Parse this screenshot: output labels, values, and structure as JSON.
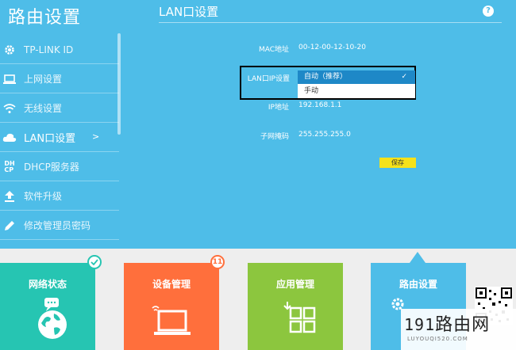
{
  "sidebar": {
    "title": "路由设置",
    "items": [
      {
        "label": "TP-LINK ID",
        "icon": "gear-icon"
      },
      {
        "label": "上网设置",
        "icon": "monitor-icon"
      },
      {
        "label": "无线设置",
        "icon": "wifi-icon"
      },
      {
        "label": "LAN口设置",
        "icon": "cloud-icon",
        "arrow": ">"
      },
      {
        "label": "DHCP服务器",
        "icon": "dhcp-icon",
        "icon_text": "DH\nCP"
      },
      {
        "label": "软件升级",
        "icon": "upload-icon"
      },
      {
        "label": "修改管理员密码",
        "icon": "pencil-icon"
      }
    ]
  },
  "main": {
    "title": "LAN口设置",
    "help": "?",
    "mac_label": "MAC地址",
    "mac_value": "00-12-00-12-10-20",
    "lan_ip_label": "LAN口IP设置",
    "select_value": "自动（推荐）",
    "option_manual": "手动",
    "ip_label": "IP地址",
    "ip_value": "192.168.1.1",
    "mask_label": "子网掩码",
    "mask_value": "255.255.255.0",
    "save_label": "保存"
  },
  "tiles": [
    {
      "label": "网络状态",
      "color": "#26c5b2"
    },
    {
      "label": "设备管理",
      "color": "#ff6f3c",
      "badge": "11"
    },
    {
      "label": "应用管理",
      "color": "#8cc63e"
    },
    {
      "label": "路由设置",
      "color": "#4ebde8"
    }
  ],
  "watermark": {
    "main_num": "191",
    "main_text": "路由网",
    "sub": "LUYOUQI520.COM"
  },
  "colors": {
    "accent": "#4ebde8",
    "select_bg": "#1e88c7",
    "save_bg": "#f5e21a"
  }
}
